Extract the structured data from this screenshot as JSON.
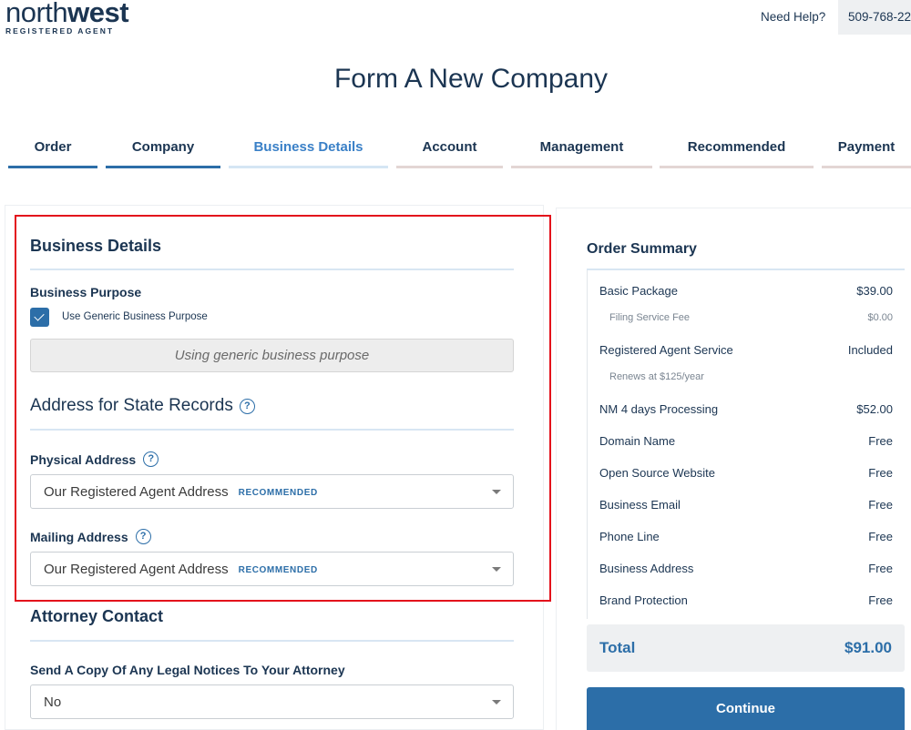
{
  "header": {
    "logo_north": "north",
    "logo_west": "west",
    "logo_sub": "REGISTERED AGENT",
    "need_help": "Need Help?",
    "phone": "509-768-22"
  },
  "page_title": "Form A New Company",
  "steps": [
    {
      "label": "Order",
      "state": "done"
    },
    {
      "label": "Company",
      "state": "done"
    },
    {
      "label": "Business Details",
      "state": "active"
    },
    {
      "label": "Account",
      "state": "pending"
    },
    {
      "label": "Management",
      "state": "pending"
    },
    {
      "label": "Recommended",
      "state": "pending"
    },
    {
      "label": "Payment",
      "state": "pending"
    }
  ],
  "business_details": {
    "title": "Business Details",
    "purpose_label": "Business Purpose",
    "generic_checkbox_label": "Use Generic Business Purpose",
    "generic_checked": true,
    "purpose_value": "Using generic business purpose"
  },
  "address": {
    "title": "Address for State Records",
    "physical_label": "Physical Address",
    "physical_value": "Our Registered Agent Address",
    "physical_tag": "RECOMMENDED",
    "mailing_label": "Mailing Address",
    "mailing_value": "Our Registered Agent Address",
    "mailing_tag": "RECOMMENDED"
  },
  "attorney": {
    "title": "Attorney Contact",
    "question": "Send A Copy Of Any Legal Notices To Your Attorney",
    "value": "No"
  },
  "order_summary": {
    "title": "Order Summary",
    "items": [
      {
        "name": "Basic Package",
        "price": "$39.00"
      },
      {
        "name": "Filing Service Fee",
        "price": "$0.00"
      },
      {
        "name": "Registered Agent Service",
        "price": "Included"
      },
      {
        "name": "Renews at $125/year",
        "price": ""
      },
      {
        "name": "NM 4 days Processing",
        "price": "$52.00"
      },
      {
        "name": "Domain Name",
        "price": "Free"
      },
      {
        "name": "Open Source Website",
        "price": "Free"
      },
      {
        "name": "Business Email",
        "price": "Free"
      },
      {
        "name": "Phone Line",
        "price": "Free"
      },
      {
        "name": "Business Address",
        "price": "Free"
      },
      {
        "name": "Brand Protection",
        "price": "Free"
      }
    ],
    "total_label": "Total",
    "total_value": "$91.00",
    "continue_label": "Continue"
  },
  "colors": {
    "primary": "#2c6ea8",
    "navy": "#1b3552",
    "highlight": "#e3101b"
  }
}
